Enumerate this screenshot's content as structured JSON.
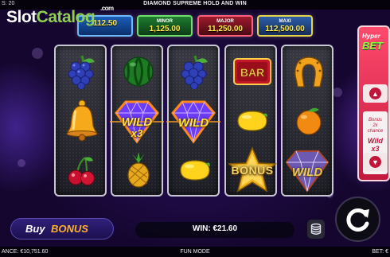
{
  "header": {
    "lines_text": "S: 20",
    "game_title": "DIAMOND SUPREME HOLD AND WIN"
  },
  "watermark": {
    "part1": "Slot",
    "part2": "Catalog",
    "suffix": ".com"
  },
  "jackpots": [
    {
      "name": "",
      "value": "112.50",
      "color": "#1a5db8"
    },
    {
      "name": "MINOR",
      "value": "1,125.00",
      "color": "#1f7b2f"
    },
    {
      "name": "MAJOR",
      "value": "11,250.00",
      "color": "#9c1b2c"
    },
    {
      "name": "MAXI",
      "value": "112,500.00",
      "color": "#2b5ea8"
    }
  ],
  "reels": [
    {
      "symbols": [
        "grapes-icon",
        "bell-icon",
        "cherries-icon"
      ]
    },
    {
      "symbols": [
        "watermelon-icon",
        "wild-x3",
        "pineapple-icon"
      ]
    },
    {
      "symbols": [
        "grapes-icon",
        "wild",
        "lemon-icon"
      ]
    },
    {
      "symbols": [
        "bar-icon",
        "lemon-icon",
        "bonus-star"
      ]
    },
    {
      "symbols": [
        "horseshoe-icon",
        "orange-icon",
        "wild"
      ]
    }
  ],
  "symbol_text": {
    "wild": "WILD",
    "x3": "x3",
    "bonus": "BONUS",
    "bar": "BAR"
  },
  "hyper_bet": {
    "title": "Hyper",
    "title2": "BET",
    "card_line1": "Bonus",
    "card_line2": "2x",
    "card_line3": "chance",
    "card_wild": "Wild",
    "card_mult": "x3"
  },
  "buy_bonus": {
    "label1": "Buy",
    "label2": "BONUS"
  },
  "win_display": "WIN: €21.60",
  "footer": {
    "balance": "ANCE: €10,751.60",
    "mode": "FUN MODE",
    "bet": "BET: €"
  },
  "colors": {
    "accent_gold": "#ffe23a",
    "buy_bonus_orange": "#ffb128",
    "hyper_green": "#8bff3b",
    "hyper_red": "#c0163a"
  }
}
